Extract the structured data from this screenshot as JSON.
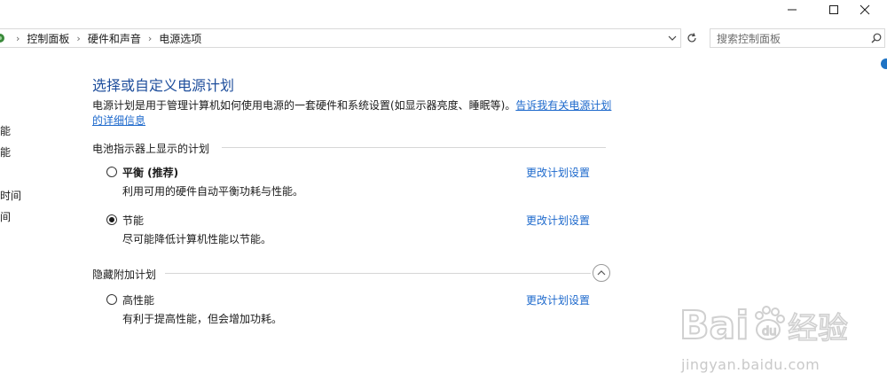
{
  "window": {
    "minimize_icon": "minimize-icon",
    "maximize_icon": "maximize-icon",
    "close_icon": "close-icon"
  },
  "breadcrumb": {
    "items": [
      "控制面板",
      "硬件和声音",
      "电源选项"
    ]
  },
  "search": {
    "placeholder": "搜索控制面板"
  },
  "sidebar": {
    "items": [
      "功能",
      "功能",
      "的时间",
      "时间"
    ]
  },
  "main": {
    "title": "选择或自定义电源计划",
    "description": "电源计划是用于管理计算机如何使用电源的一套硬件和系统设置(如显示器亮度、睡眠等)。",
    "description_link": "告诉我有关电源计划的详细信息",
    "battery_group_label": "电池指示器上显示的计划",
    "hidden_group_label": "隐藏附加计划",
    "change_label": "更改计划设置",
    "plans": [
      {
        "name": "平衡 (推荐)",
        "description": "利用可用的硬件自动平衡功耗与性能。",
        "selected": false
      },
      {
        "name": "节能",
        "description": "尽可能降低计算机性能以节能。",
        "selected": true
      },
      {
        "name": "高性能",
        "description": "有利于提高性能，但会增加功耗。",
        "selected": false
      }
    ]
  },
  "watermark": {
    "brand": "Bai经验",
    "url": "jingyan.baidu.com"
  },
  "colors": {
    "title_blue": "#1e4e9c",
    "link_blue": "#1d69cc"
  }
}
